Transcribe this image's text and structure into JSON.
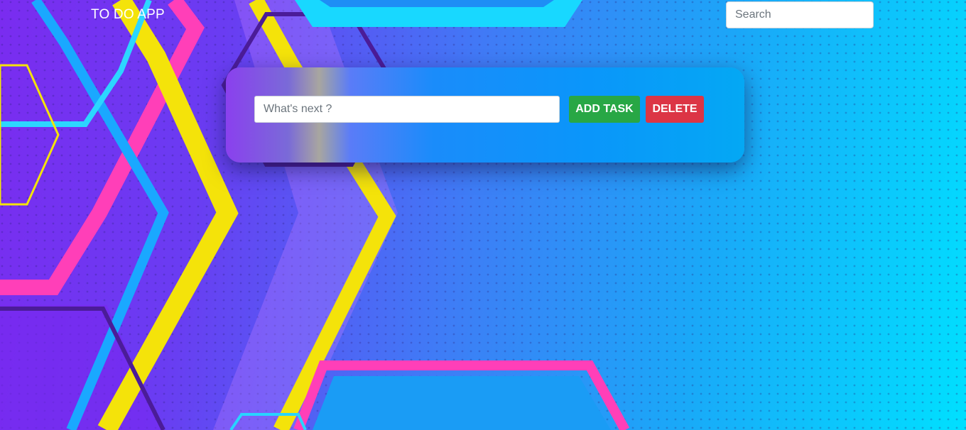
{
  "navbar": {
    "brand": "TO DO APP",
    "search_placeholder": "Search"
  },
  "task_form": {
    "input_placeholder": "What's next ?",
    "add_label": "ADD TASK",
    "delete_label": "DELETE"
  },
  "colors": {
    "add_button": "#28a745",
    "delete_button": "#dc3545",
    "accent_cyan": "#00e0ff",
    "accent_purple": "#7a2cf0"
  }
}
